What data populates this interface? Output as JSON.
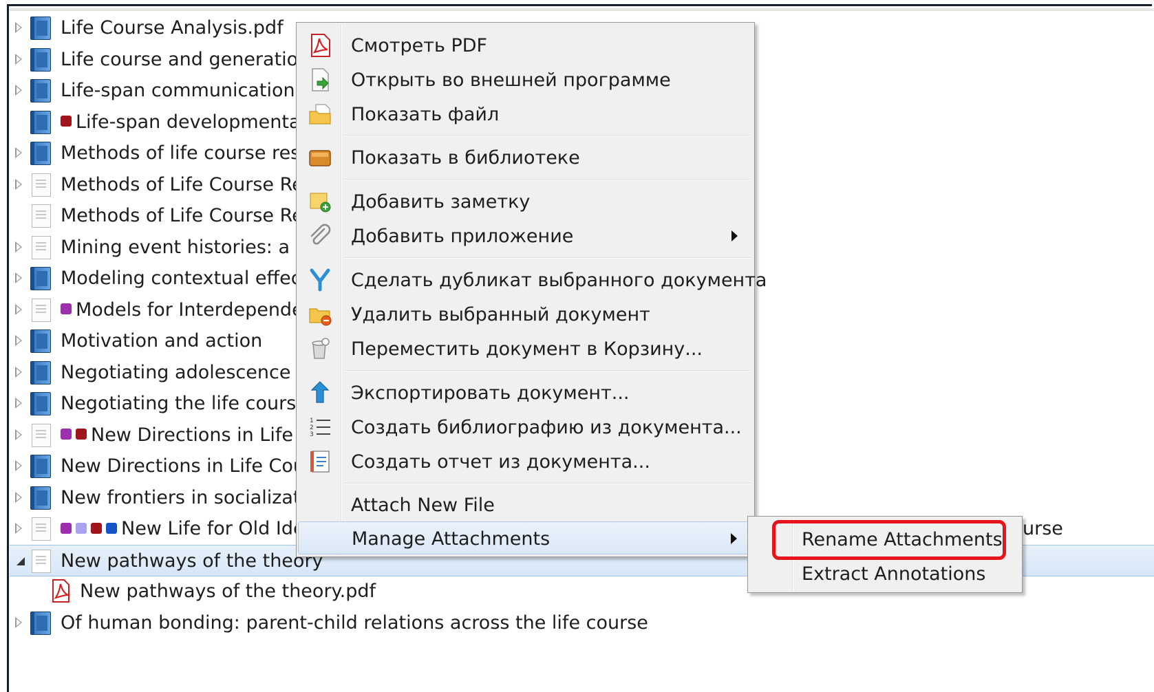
{
  "tree": {
    "rows": [
      {
        "title": "Life Course Analysis.pdf",
        "icon": "book-icon",
        "expander": "collapsed",
        "tags": []
      },
      {
        "title": "Life course and generational",
        "icon": "book-icon",
        "expander": "collapsed",
        "tags": []
      },
      {
        "title": "Life-span communication",
        "icon": "book-icon",
        "expander": "collapsed",
        "tags": []
      },
      {
        "title": "Life-span developmental p",
        "icon": "book-icon",
        "expander": "none",
        "tags": [
          "#a0141c"
        ]
      },
      {
        "title": "Methods of life course resea",
        "icon": "book-icon",
        "expander": "collapsed",
        "tags": []
      },
      {
        "title": "Methods of Life Course Rese",
        "icon": "page-icon",
        "expander": "collapsed",
        "tags": []
      },
      {
        "title": "Methods of Life Course Rese",
        "icon": "page-icon",
        "expander": "none",
        "tags": []
      },
      {
        "title": "Mining event histories: a soc",
        "icon": "page-icon",
        "expander": "collapsed",
        "tags": []
      },
      {
        "title": "Modeling contextual effects",
        "icon": "book-icon",
        "expander": "collapsed",
        "tags": []
      },
      {
        "title": "Models for Interdependen",
        "icon": "page-icon",
        "expander": "collapsed",
        "tags": [
          "#9b2fae"
        ]
      },
      {
        "title": "Motivation and action",
        "icon": "book-icon",
        "expander": "collapsed",
        "tags": []
      },
      {
        "title": "Negotiating adolescence in t",
        "icon": "book-icon",
        "expander": "collapsed",
        "tags": []
      },
      {
        "title": "Negotiating the life course: s",
        "icon": "book-icon",
        "expander": "collapsed",
        "tags": []
      },
      {
        "title": "New Directions in Life C",
        "icon": "page-icon",
        "expander": "collapsed",
        "tags": [
          "#9b2fae",
          "#a0141c"
        ]
      },
      {
        "title": "New Directions in Life Cours",
        "icon": "book-icon",
        "expander": "collapsed",
        "tags": []
      },
      {
        "title": "New frontiers in socializatio",
        "icon": "book-icon",
        "expander": "collapsed",
        "tags": []
      },
      {
        "title": "New Life for Old Ide",
        "icon": "page-icon",
        "expander": "collapsed",
        "tags": [
          "#9b2fae",
          "#a8a2f0",
          "#a0141c",
          "#1552c4"
        ],
        "tail": "urse"
      },
      {
        "title": "New pathways of the theory",
        "icon": "page-icon",
        "expander": "expanded",
        "tags": [],
        "selected": true
      },
      {
        "title": "New pathways of the theory.pdf",
        "icon": "pdf-icon",
        "expander": "child",
        "tags": []
      },
      {
        "title": "Of human bonding: parent-child relations across the life course",
        "icon": "book-icon",
        "expander": "collapsed",
        "tags": []
      }
    ]
  },
  "context_menu": {
    "items": [
      {
        "label": "Смотреть PDF",
        "icon": "pdf-icon"
      },
      {
        "label": "Открыть во внешней программе",
        "icon": "open-external-icon"
      },
      {
        "label": "Показать файл",
        "icon": "folder-icon"
      },
      {
        "label": "Показать в библиотеке",
        "icon": "library-icon"
      },
      {
        "label": "Добавить заметку",
        "icon": "add-note-icon"
      },
      {
        "label": "Добавить приложение",
        "icon": "paperclip-icon",
        "submenu": true
      },
      {
        "label": "Сделать дубликат выбранного документа",
        "icon": "duplicate-icon"
      },
      {
        "label": "Удалить выбранный документ",
        "icon": "delete-document-icon"
      },
      {
        "label": "Переместить документ в Корзину...",
        "icon": "trash-icon"
      },
      {
        "label": "Экспортировать документ...",
        "icon": "export-icon"
      },
      {
        "label": "Создать библиографию из документа...",
        "icon": "bibliography-list-icon"
      },
      {
        "label": "Создать отчет из документа...",
        "icon": "report-icon"
      },
      {
        "label": "Attach New File",
        "icon": ""
      },
      {
        "label": "Manage Attachments",
        "icon": "",
        "submenu": true,
        "highlighted": true
      }
    ]
  },
  "submenu": {
    "items": [
      {
        "label": "Rename Attachments",
        "highlighted_box": true
      },
      {
        "label": "Extract Annotations"
      }
    ]
  },
  "colors": {
    "selection": "#d6e6f8",
    "menu_bg": "#f0f0f0",
    "highlight_box": "#e8141c"
  }
}
